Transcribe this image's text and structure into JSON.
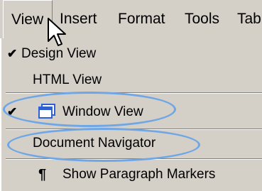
{
  "menubar": {
    "items": [
      "View",
      "Insert",
      "Format",
      "Tools",
      "Tab"
    ]
  },
  "menu": {
    "design_view": "Design View",
    "html_view": "HTML View",
    "window_view": "Window View",
    "document_navigator": "Document Navigator",
    "show_paragraph_markers": "Show Paragraph Markers"
  },
  "icons": {
    "checkmark": "checkmark-icon",
    "window": "window-view-icon",
    "pilcrow": "paragraph-mark-icon",
    "cursor": "mouse-pointer-icon"
  },
  "colors": {
    "menu_bg": "#d4d0c8",
    "highlight_ring": "#6fa6e6",
    "window_icon_blue": "#2f5fd0"
  }
}
